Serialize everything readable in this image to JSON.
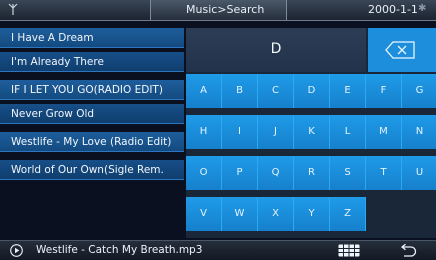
{
  "header": {
    "title": "Music>Search",
    "date": "2000-1-1"
  },
  "results": [
    "I Have A Dream",
    "I'm Already There",
    "IF I LET YOU GO(RADIO EDIT)",
    "Never Grow Old",
    "Westlife - My Love (Radio Edit)",
    " World of Our Own(Sigle Rem."
  ],
  "keyboard": {
    "input_value": "D",
    "keys": [
      "A",
      "B",
      "C",
      "D",
      "E",
      "F",
      "G",
      "H",
      "I",
      "J",
      "K",
      "L",
      "M",
      "N",
      "O",
      "P",
      "Q",
      "R",
      "S",
      "T",
      "U",
      "V",
      "W",
      "X",
      "Y",
      "Z"
    ]
  },
  "player": {
    "now_playing": "Westlife - Catch My Breath.mp3"
  }
}
